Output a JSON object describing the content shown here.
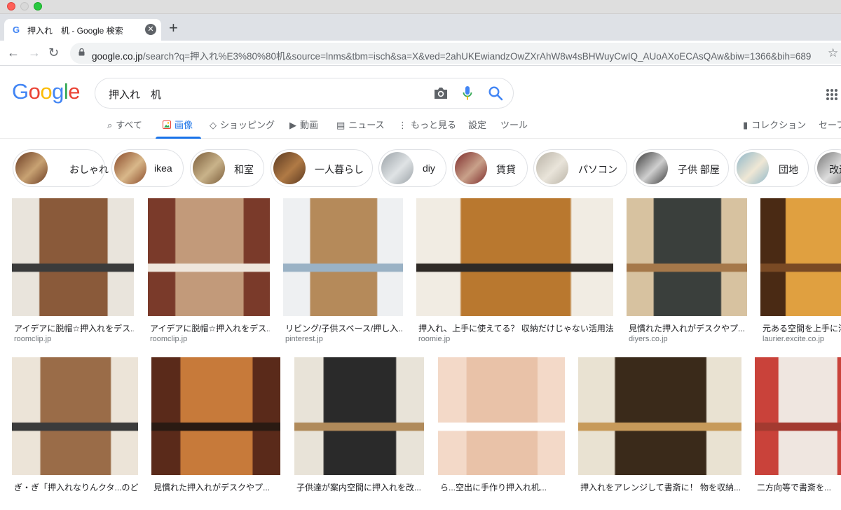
{
  "browser": {
    "tab_favicon": "G",
    "tab_title": "押入れ　机 - Google 検索",
    "new_tab_label": "+",
    "url_host": "google.co.jp",
    "url_path": "/search?q=押入れ%E3%80%80机&source=lnms&tbm=isch&sa=X&ved=2ahUKEwiandzOwZXrAhW8w4sBHWuyCwIQ_AUoAXoECAsQAw&biw=1366&bih=689"
  },
  "logo": {
    "letters": [
      "G",
      "o",
      "o",
      "g",
      "l",
      "e"
    ],
    "colors": [
      "#4285f4",
      "#ea4335",
      "#fbbc05",
      "#4285f4",
      "#34a853",
      "#ea4335"
    ]
  },
  "search": {
    "query": "押入れ　机"
  },
  "tabs": [
    {
      "label": "すべて",
      "icon": "search-icon"
    },
    {
      "label": "画像",
      "icon": "image-icon",
      "active": true
    },
    {
      "label": "ショッピング",
      "icon": "tag-icon"
    },
    {
      "label": "動画",
      "icon": "play-icon"
    },
    {
      "label": "ニュース",
      "icon": "news-icon"
    },
    {
      "label": "もっと見る",
      "icon": "more-icon"
    },
    {
      "label": "設定"
    },
    {
      "label": "ツール"
    },
    {
      "label": "コレクション",
      "icon": "bookmark-icon"
    },
    {
      "label": "セーフ"
    }
  ],
  "chips": [
    {
      "label": "おしゃれ",
      "colors": [
        "#6b3b22",
        "#c8a273"
      ]
    },
    {
      "label": "ikea",
      "colors": [
        "#8a4a2a",
        "#d9b88a"
      ]
    },
    {
      "label": "和室",
      "colors": [
        "#7a5c3a",
        "#c9b38a"
      ]
    },
    {
      "label": "一人暮らし",
      "colors": [
        "#5a3820",
        "#b07a45"
      ]
    },
    {
      "label": "diy",
      "colors": [
        "#9aa1a6",
        "#dfe3e5"
      ]
    },
    {
      "label": "賃貸",
      "colors": [
        "#7d2a2a",
        "#c9a18a"
      ]
    },
    {
      "label": "パソコン",
      "colors": [
        "#b9b3a6",
        "#e9e4da"
      ]
    },
    {
      "label": "子供 部屋",
      "colors": [
        "#3a3a3a",
        "#cfcfcf"
      ]
    },
    {
      "label": "団地",
      "colors": [
        "#8fb7c9",
        "#efe7d5"
      ]
    },
    {
      "label": "改造",
      "colors": [
        "#777",
        "#ddd"
      ]
    }
  ],
  "results_row1": [
    {
      "title": "アイデアに脱帽☆押入れをデス...",
      "source": "roomclip.jp",
      "colors": [
        "#e9e4dc",
        "#8a5a3a",
        "#3b3b3b"
      ]
    },
    {
      "title": "アイデアに脱帽☆押入れをデス...",
      "source": "roomclip.jp",
      "colors": [
        "#7a3a2a",
        "#c29a7a",
        "#efe6dc"
      ]
    },
    {
      "title": "リビング/子供スペース/押し入...",
      "source": "pinterest.jp",
      "colors": [
        "#eef0f2",
        "#b58a5a",
        "#9ab2c5"
      ]
    },
    {
      "title": "押入れ、上手に使えてる？ 収納だけじゃない活用法...",
      "source": "roomie.jp",
      "colors": [
        "#f1ece3",
        "#b9782f",
        "#2f2a26"
      ]
    },
    {
      "title": "見慣れた押入れがデスクやプ...",
      "source": "diyers.co.jp",
      "colors": [
        "#d7c2a0",
        "#3a3f3c",
        "#a5784a"
      ]
    },
    {
      "title": "元ある空間を上手に活",
      "source": "laurier.excite.co.jp",
      "colors": [
        "#4a2a14",
        "#e0a040",
        "#7a4a24"
      ]
    }
  ],
  "results_row2": [
    {
      "title": "ぎ・ぎ「押入れなりんクタ...のどん",
      "colors": [
        "#ece4d8",
        "#9a6c48",
        "#3b3b3b"
      ]
    },
    {
      "title": "見慣れた押入れがデスクやプ...",
      "colors": [
        "#5a2a1a",
        "#c77a3a",
        "#2a1a12"
      ]
    },
    {
      "title": "子供達が案内空間に押入れを改...",
      "colors": [
        "#e8e3d8",
        "#2a2a2a",
        "#b08a5a"
      ]
    },
    {
      "title": "ら...空出に手作り押入れ机...",
      "colors": [
        "#f3d9c8",
        "#e9c2a8",
        "#ffffff"
      ]
    },
    {
      "title": "押入れをアレンジして書斎に！ 物を収納...",
      "colors": [
        "#e9e2d2",
        "#3a2a1a",
        "#c79a5a"
      ]
    },
    {
      "title": "二方向等で書斎を...",
      "colors": [
        "#c9423a",
        "#efe6e0",
        "#a33a30"
      ]
    }
  ]
}
